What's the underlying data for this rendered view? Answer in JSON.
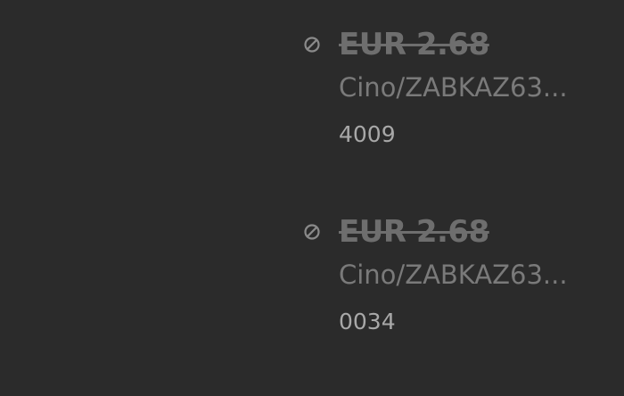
{
  "transactions": [
    {
      "status_icon": "blocked-icon",
      "amount": "EUR 2.68",
      "merchant": "Cino/ZABKAZ63...",
      "card": "4009"
    },
    {
      "status_icon": "blocked-icon",
      "amount": "EUR 2.68",
      "merchant": "Cino/ZABKAZ63...",
      "card": "0034"
    }
  ],
  "colors": {
    "background": "#2b2b2b",
    "amount": "#6e6e6e",
    "merchant": "#7a7a7a",
    "card": "#a8a8a8"
  }
}
